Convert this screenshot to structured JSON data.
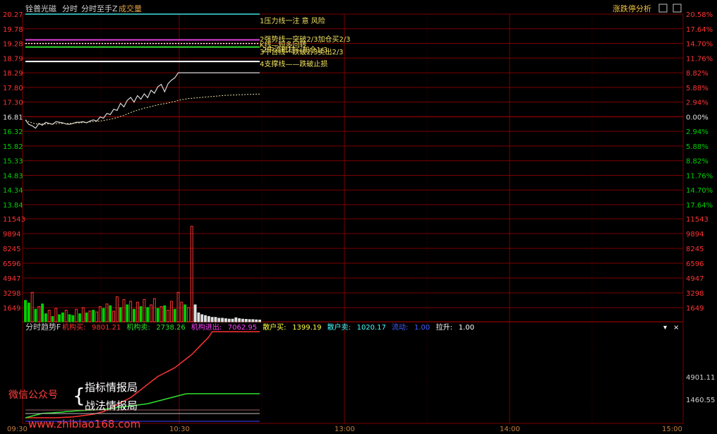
{
  "header": {
    "stock_name": "铨普光磁",
    "tab_fenshi": "分时",
    "indicator": "分时至手Z",
    "volume_label": "成交量",
    "right_title": "涨跌停分析"
  },
  "colors": {
    "bg": "#000000",
    "grid": "#7a0000",
    "up": "#ff3333",
    "down": "#00d000",
    "price_line": "#d8d8d8",
    "avg_line": "#e8e0a0",
    "cyan": "#40e0e0",
    "magenta": "#e040e0",
    "green_line": "#30e030",
    "white_line": "#ffffff",
    "yellow_text": "#f0e060"
  },
  "annotations": [
    {
      "text": "1压力线一注 意 风险",
      "color": "#f0e060"
    },
    {
      "text": "2强势线一突破2/3加仓买2/3",
      "color": "#f0e060"
    },
    {
      "text": "3平台线一跌破2/3卖出2/3",
      "color": "#f0e060"
    },
    {
      "text": "4支撑线——跌破止损",
      "color": "#f0e060"
    },
    {
      "text": "K线—短多回转",
      "color": "#f0e060"
    },
    {
      "text": "2中流砥柱—加仓1/3",
      "color": "#f0e060"
    }
  ],
  "lower_panel": {
    "label": "分时趋势F",
    "items": [
      {
        "label": "机构买:",
        "value": "9801.21",
        "color": "#ff3333"
      },
      {
        "label": "机构卖:",
        "value": "2738.26",
        "color": "#30e030"
      },
      {
        "label": "机构进出:",
        "value": "7062.95",
        "color": "#ff40ff"
      },
      {
        "label": "散户买:",
        "value": "1399.19",
        "color": "#ffff40"
      },
      {
        "label": "散户卖:",
        "value": "1020.17",
        "color": "#40ffff"
      },
      {
        "label": "流动:",
        "value": "1.00",
        "color": "#4060ff"
      },
      {
        "label": "拉升:",
        "value": "1.00",
        "color": "#ffffff"
      }
    ],
    "axis_right": [
      "4901.11",
      "1460.55"
    ]
  },
  "watermark": {
    "label": "微信公众号",
    "line1": "指标情报局",
    "line2": "战法情报局",
    "url": "www.zhibiao168.com"
  },
  "chart_data": [
    {
      "type": "line",
      "panel": "price",
      "y_ticks_left": [
        "20.27",
        "19.78",
        "19.28",
        "18.79",
        "18.29",
        "17.80",
        "17.30",
        "16.81",
        "16.32",
        "15.82",
        "15.33",
        "14.83",
        "14.34",
        "13.84"
      ],
      "y_ticks_right": [
        "20.58%",
        "17.64%",
        "14.70%",
        "11.76%",
        "8.82%",
        "5.88%",
        "2.94%",
        "0.00%",
        "2.94%",
        "5.88%",
        "8.82%",
        "11.76%",
        "14.70%",
        "17.64%"
      ],
      "ylim": [
        13.84,
        20.27
      ],
      "x_ticks": [
        "09:30",
        "10:30",
        "13:00",
        "14:00",
        "15:00"
      ],
      "reference_lines": [
        {
          "name": "压力线",
          "value": 20.27
        },
        {
          "name": "强势线",
          "value": 19.4
        },
        {
          "name": "平台线",
          "value": 19.28
        },
        {
          "name": "中流砥柱",
          "value": 19.16
        },
        {
          "name": "支撑线",
          "value": 18.67
        }
      ],
      "price": [
        16.7,
        16.55,
        16.5,
        16.42,
        16.58,
        16.52,
        16.62,
        16.58,
        16.55,
        16.64,
        16.62,
        16.6,
        16.56,
        16.55,
        16.58,
        16.62,
        16.62,
        16.64,
        16.6,
        16.66,
        16.7,
        16.66,
        16.8,
        16.76,
        16.92,
        16.88,
        17.06,
        17.02,
        17.26,
        17.14,
        17.36,
        17.46,
        17.3,
        17.52,
        17.4,
        17.58,
        17.45,
        17.7,
        17.6,
        17.82,
        17.9,
        17.65,
        17.92,
        18.04,
        18.12,
        18.29,
        18.29,
        18.29,
        18.29,
        18.29,
        18.29,
        18.29,
        18.29,
        18.29,
        18.29,
        18.29,
        18.29,
        18.29,
        18.29,
        18.29,
        18.29,
        18.29,
        18.29,
        18.29,
        18.29,
        18.29,
        18.29,
        18.29,
        18.29,
        18.29
      ],
      "avg": [
        16.7,
        16.64,
        16.6,
        16.57,
        16.56,
        16.56,
        16.56,
        16.57,
        16.57,
        16.57,
        16.58,
        16.58,
        16.58,
        16.58,
        16.59,
        16.6,
        16.6,
        16.61,
        16.62,
        16.63,
        16.64,
        16.65,
        16.66,
        16.68,
        16.7,
        16.72,
        16.75,
        16.78,
        16.82,
        16.85,
        16.9,
        16.95,
        16.99,
        17.03,
        17.06,
        17.1,
        17.12,
        17.15,
        17.18,
        17.21,
        17.23,
        17.25,
        17.27,
        17.3,
        17.32,
        17.36,
        17.38,
        17.4,
        17.42,
        17.43,
        17.44,
        17.45,
        17.46,
        17.47,
        17.48,
        17.49,
        17.5,
        17.51,
        17.52,
        17.53,
        17.53,
        17.54,
        17.54,
        17.55,
        17.55,
        17.56,
        17.56,
        17.56,
        17.57,
        17.57
      ]
    },
    {
      "type": "bar",
      "panel": "volume",
      "y_ticks": [
        "11543",
        "9894",
        "8245",
        "6596",
        "4947",
        "3298",
        "1649"
      ],
      "ylim": [
        0,
        11543
      ],
      "values": [
        2400,
        2100,
        3300,
        1400,
        1700,
        2000,
        900,
        1300,
        600,
        1500,
        800,
        1000,
        1300,
        800,
        700,
        1400,
        900,
        1600,
        1000,
        1200,
        1300,
        1100,
        1700,
        1500,
        2000,
        1800,
        1200,
        2800,
        1600,
        2500,
        1900,
        2300,
        1400,
        2200,
        1700,
        2500,
        1600,
        1900,
        2600,
        1500,
        1700,
        1800,
        1300,
        2300,
        1400,
        3300,
        2200,
        1900,
        1600,
        10700,
        1900,
        1000,
        800,
        700,
        600,
        500,
        500,
        400,
        400,
        350,
        300,
        300,
        450,
        350,
        300,
        280,
        250,
        250,
        220,
        200
      ],
      "colors": [
        "down",
        "down",
        "up",
        "down",
        "up",
        "down",
        "down",
        "up",
        "down",
        "up",
        "down",
        "down",
        "up",
        "down",
        "down",
        "up",
        "down",
        "up",
        "down",
        "up",
        "down",
        "up",
        "up",
        "down",
        "up",
        "down",
        "up",
        "up",
        "down",
        "up",
        "down",
        "up",
        "down",
        "up",
        "down",
        "up",
        "down",
        "up",
        "up",
        "down",
        "up",
        "down",
        "up",
        "up",
        "down",
        "up",
        "up",
        "down",
        "up",
        "up",
        "white",
        "white",
        "white",
        "white",
        "white",
        "white",
        "white",
        "white",
        "white",
        "white",
        "white",
        "white",
        "white",
        "white",
        "white",
        "white",
        "white",
        "white",
        "white",
        "white"
      ]
    },
    {
      "type": "line",
      "panel": "trend",
      "series": [
        {
          "name": "机构买",
          "color": "#ff3333",
          "values": [
            0,
            0,
            0,
            0,
            0,
            0,
            0,
            0,
            0,
            0,
            20,
            40,
            60,
            80,
            100,
            150,
            200,
            250,
            300,
            350,
            400,
            500,
            600,
            700,
            900,
            1100,
            1300,
            1500,
            1700,
            1900,
            2100,
            2300,
            2600,
            2900,
            3200,
            3500,
            3800,
            4100,
            4400,
            4700,
            4901,
            5100,
            5300,
            5500,
            5700,
            6000,
            6300,
            6600,
            6900,
            7200,
            7600,
            8000,
            8400,
            8800,
            9200,
            9801,
            9801,
            9801,
            9801,
            9801,
            9801,
            9801,
            9801,
            9801,
            9801,
            9801,
            9801,
            9801,
            9801,
            9801
          ]
        },
        {
          "name": "机构卖",
          "color": "#30e030",
          "values": [
            0,
            100,
            200,
            300,
            400,
            500,
            520,
            540,
            560,
            600,
            620,
            650,
            700,
            720,
            750,
            780,
            800,
            820,
            840,
            860,
            880,
            900,
            920,
            960,
            1000,
            1050,
            1100,
            1150,
            1200,
            1250,
            1300,
            1350,
            1400,
            1450,
            1500,
            1550,
            1600,
            1700,
            1800,
            1900,
            2000,
            2100,
            2200,
            2300,
            2400,
            2500,
            2600,
            2700,
            2738,
            2738,
            2738,
            2738,
            2738,
            2738,
            2738,
            2738,
            2738,
            2738,
            2738,
            2738,
            2738,
            2738,
            2738,
            2738,
            2738,
            2738,
            2738,
            2738,
            2738,
            2738
          ]
        }
      ]
    }
  ]
}
